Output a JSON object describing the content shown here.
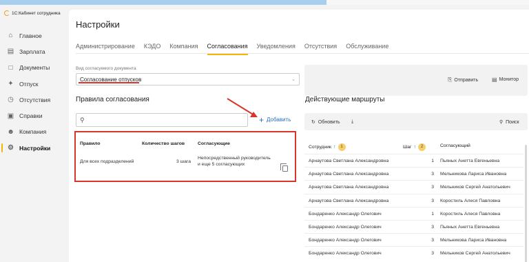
{
  "app": {
    "name": "1С:Кабинет сотрудника"
  },
  "sidebar": {
    "items": [
      {
        "label": "Главное",
        "icon": "home-icon"
      },
      {
        "label": "Зарплата",
        "icon": "salary-icon"
      },
      {
        "label": "Документы",
        "icon": "documents-icon"
      },
      {
        "label": "Отпуск",
        "icon": "vacation-icon"
      },
      {
        "label": "Отсутствия",
        "icon": "absence-icon"
      },
      {
        "label": "Справки",
        "icon": "certificate-icon"
      },
      {
        "label": "Компания",
        "icon": "company-icon"
      },
      {
        "label": "Настройки",
        "icon": "gear-icon",
        "active": true
      }
    ]
  },
  "page": {
    "title": "Настройки"
  },
  "tabs": [
    "Администрирование",
    "КЭДО",
    "Компания",
    "Согласования",
    "Уведомления",
    "Отсутствия",
    "Обслуживание"
  ],
  "active_tab": "Согласования",
  "doc_type": {
    "label": "Вид согласуемого документа",
    "value": "Согласование отпусков"
  },
  "toolbar_right": {
    "send": "Отправить",
    "monitor": "Монитор"
  },
  "rules": {
    "title": "Правила согласования",
    "add_label": "Добавить",
    "headers": {
      "rule": "Правило",
      "steps": "Количество шагов",
      "approvers": "Согласующие"
    },
    "row": {
      "rule": "Для всех подразделений",
      "steps": "3 шага",
      "approvers_line1": "Непосредственный руководитель",
      "approvers_line2": "и еще 5 согласующих"
    }
  },
  "routes": {
    "title": "Действующие маршруты",
    "refresh": "Обновить",
    "search": "Поиск",
    "headers": {
      "employee": "Сотрудник",
      "employee_sort": "1",
      "step": "Шаг",
      "step_sort": "2",
      "approver": "Согласующий"
    },
    "rows": [
      {
        "employee": "Арнаутова Светлана Александровна",
        "step": "1",
        "approver": "Пьяных Анетта Евгеньевна"
      },
      {
        "employee": "Арнаутова Светлана Александровна",
        "step": "3",
        "approver": "Мельникова Лариса Ивановна"
      },
      {
        "employee": "Арнаутова Светлана Александровна",
        "step": "3",
        "approver": "Мельников Сергей Анатольевич"
      },
      {
        "employee": "Арнаутова Светлана Александровна",
        "step": "3",
        "approver": "Коростиль Алеся Павловна"
      },
      {
        "employee": "Бондаренко Александр Олегович",
        "step": "1",
        "approver": "Коростиль Алеся Павловна"
      },
      {
        "employee": "Бондаренко Александр Олегович",
        "step": "3",
        "approver": "Пьяных Анетта Евгеньевна"
      },
      {
        "employee": "Бондаренко Александр Олегович",
        "step": "3",
        "approver": "Мельникова Лариса Ивановна"
      },
      {
        "employee": "Бондаренко Александр Олегович",
        "step": "3",
        "approver": "Мельников Сергей Анатольевич"
      }
    ]
  },
  "colors": {
    "accent": "#f2b705",
    "link": "#2a6fb5",
    "highlight": "#d9342b"
  }
}
